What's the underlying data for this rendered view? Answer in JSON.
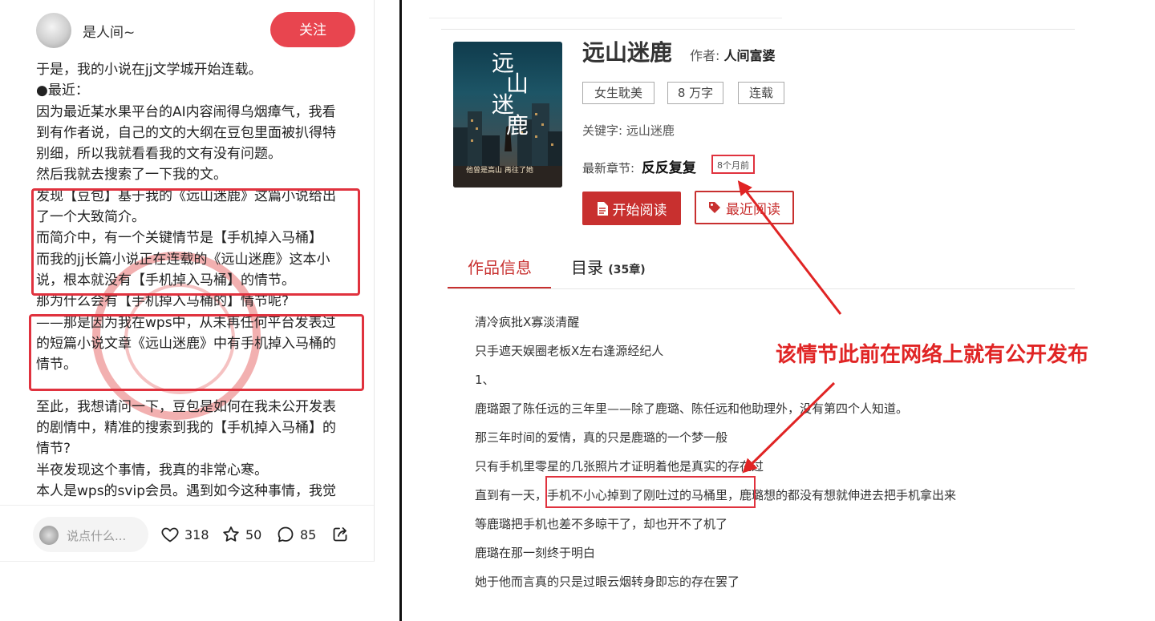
{
  "left_post": {
    "username": "是人间~",
    "follow_label": "关注",
    "lines": [
      "于是，我的小说在jj文学城开始连载。",
      "●最近：",
      "因为最近某水果平台的AI内容闹得乌烟瘴气，我看",
      "到有作者说，自己的文的大纲在豆包里面被扒得特",
      "别细，所以我就看看我的文有没有问题。",
      "然后我就去搜索了一下我的文。",
      "发现【豆包】基于我的《远山迷鹿》这篇小说给出",
      "了一个大致简介。",
      "而简介中，有一个关键情节是【手机掉入马桶】",
      "而我的jj长篇小说正在连载的《远山迷鹿》这本小",
      "说，根本就没有【手机掉入马桶】的情节。",
      "那为什么会有【手机掉入马桶的】情节呢?",
      "——那是因为我在wps中，从未再任何平台发表过",
      "的短篇小说文章《远山迷鹿》中有手机掉入马桶的",
      "情节。",
      "",
      "至此，我想请问一下，豆包是如何在我未公开发表",
      "的剧情中，精准的搜索到我的【手机掉入马桶】的",
      "情节?",
      "半夜发现这个事情，我真的非常心寒。",
      "本人是wps的svip会员。遇到如今这种事情，我觉"
    ],
    "footer": {
      "comment_placeholder": "说点什么...",
      "likes": "318",
      "stars": "50",
      "comments": "85"
    },
    "icons": [
      "heart-icon",
      "star-icon",
      "comment-icon",
      "share-icon"
    ]
  },
  "book": {
    "cover_title": "远山迷鹿",
    "cover_subtitle": "他曾是高山 再往了她",
    "title": "远山迷鹿",
    "author_label": "作者:",
    "author": "人间富婆",
    "tags": [
      "女生耽美",
      "8 万字",
      "连载"
    ],
    "keywords_label": "关键字:",
    "keywords": "远山迷鹿",
    "latest_label": "最新章节:",
    "latest_chapter": "反反复复",
    "latest_time": "8个月前",
    "start_read_label": "开始阅读",
    "recent_read_label": "最近阅读",
    "tab_info": "作品信息",
    "tab_toc": "目录",
    "tab_toc_count": "(35章)",
    "description": [
      "清冷疯批X寡淡清醒",
      "只手遮天娱圈老板X左右逢源经纪人",
      "1、",
      "鹿璐跟了陈任远的三年里——除了鹿璐、陈任远和他助理外，没有第四个人知道。",
      "那三年时间的爱情，真的只是鹿璐的一个梦一般",
      "只有手机里零星的几张照片才证明着他是真实的存在过",
      "直到有一天，手机不小心掉到了刚吐过的马桶里，鹿璐想的都没有想就伸进去把手机拿出来",
      "等鹿璐把手机也差不多晾干了，却也开不了机了",
      "鹿璐在那一刻终于明白",
      "她于他而言真的只是过眼云烟转身即忘的存在罢了"
    ]
  },
  "annotation": "该情节此前在网络上就有公开发布",
  "colors": {
    "accent_red": "#e8454f",
    "button_red": "#c8302f",
    "annotation_red": "#e02424"
  }
}
